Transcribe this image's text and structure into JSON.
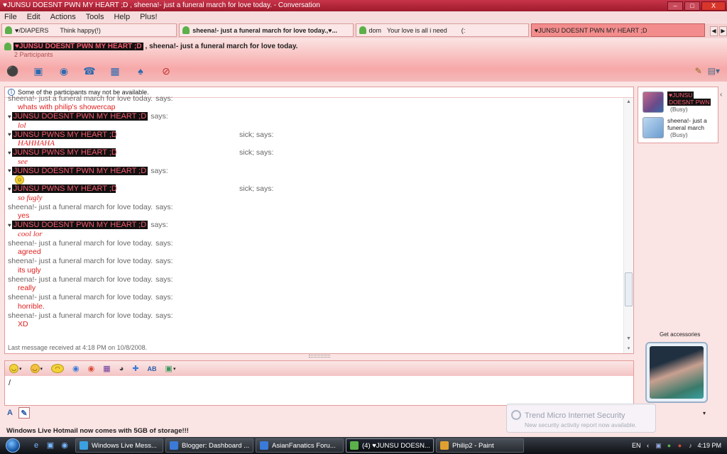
{
  "window": {
    "title": "♥JUNSU DOESNT PWN MY HEART ;D , sheena!- just a funeral march for love today. - Conversation",
    "btn_min": "–",
    "btn_max": "□",
    "btn_close": "X"
  },
  "menu": [
    "File",
    "Edit",
    "Actions",
    "Tools",
    "Help",
    "Plus!"
  ],
  "tabs": [
    {
      "name": "♥/DIAPERS",
      "msg": "Think happy(!)"
    },
    {
      "name": "sheena!- just a funeral march for love today.,♥...",
      "msg": ""
    },
    {
      "name": "dom",
      "msg": "Your love is all i need        (:"
    },
    {
      "name": "♥JUNSU DOESNT PWN MY HEART ;D",
      "msg": ""
    }
  ],
  "header": {
    "participant1": "♥JUNSU DOESNT PWN MY HEART ;D",
    "participant2": ", sheena!- just a funeral march for love today.",
    "count": "2 Participants"
  },
  "notice": "Some of the participants may not be available.",
  "messages": [
    {
      "name": "sheena!- just a funeral march for love today.",
      "says": "says:",
      "text": "whats with philip's showercap",
      "style": "sans"
    },
    {
      "name": "JUNSU DOESNT PWN MY HEART ;D",
      "says": "says:",
      "text": "lol",
      "style": "serif"
    },
    {
      "name": "JUNSU PWNS MY HEART ;D",
      "says": "sick; says:",
      "text": "HAHHAHA",
      "style": "serif"
    },
    {
      "name": "JUNSU PWNS MY HEART ;D",
      "says": "sick; says:",
      "text": "see",
      "style": "serif"
    },
    {
      "name": "JUNSU DOESNT PWN MY HEART ;D",
      "says": "says:",
      "text": "☺",
      "style": "smiley"
    },
    {
      "name": "JUNSU PWNS MY HEART ;D",
      "says": "sick; says:",
      "text": "so fugly",
      "style": "serif"
    },
    {
      "name": "sheena!- just a funeral march for love today.",
      "says": "says:",
      "text": "yes",
      "style": "sans"
    },
    {
      "name": "JUNSU DOESNT PWN MY HEART ;D",
      "says": "says:",
      "text": "cool lor",
      "style": "serif"
    },
    {
      "name": "sheena!- just a funeral march for love today.",
      "says": "says:",
      "text": "agreed",
      "style": "sans"
    },
    {
      "name": "sheena!- just a funeral march for love today.",
      "says": "says:",
      "text": "its ugly",
      "style": "sans"
    },
    {
      "name": "sheena!- just a funeral march for love today.",
      "says": "says:",
      "text": "really",
      "style": "sans"
    },
    {
      "name": "sheena!- just a funeral march for love today.",
      "says": "says:",
      "text": "horrible.",
      "style": "sans"
    },
    {
      "name": "sheena!- just a funeral march for love today.",
      "says": "says:",
      "text": "XD",
      "style": "sans"
    }
  ],
  "last_message": "Last message received at 4:18 PM on 10/8/2008.",
  "compose": {
    "value": "/"
  },
  "promo": "Windows Live Hotmail now comes with 5GB of storage!!!",
  "contacts": [
    {
      "name1": "♥JUNSU",
      "name2": "DOESNT PWN",
      "status": "(Busy)"
    },
    {
      "name1": "sheena!- just a",
      "name2": "funeral march",
      "status": "(Busy)"
    }
  ],
  "get_accessories": "Get accessories",
  "toast": {
    "title": "Trend Micro Internet Security",
    "body": "New security activity report now available."
  },
  "taskbar": {
    "items": [
      {
        "label": "Windows Live Mess...",
        "color": "#3aa0e0"
      },
      {
        "label": "Blogger: Dashboard ...",
        "color": "#3a7ad8"
      },
      {
        "label": "AsianFanatics Foru...",
        "color": "#3a7ad8"
      },
      {
        "label": "(4) ♥JUNSU DOESN...",
        "color": "#5bb04a"
      },
      {
        "label": "Philip2 - Paint",
        "color": "#e0a030"
      }
    ],
    "lang": "EN",
    "clock": "4:19 PM"
  }
}
